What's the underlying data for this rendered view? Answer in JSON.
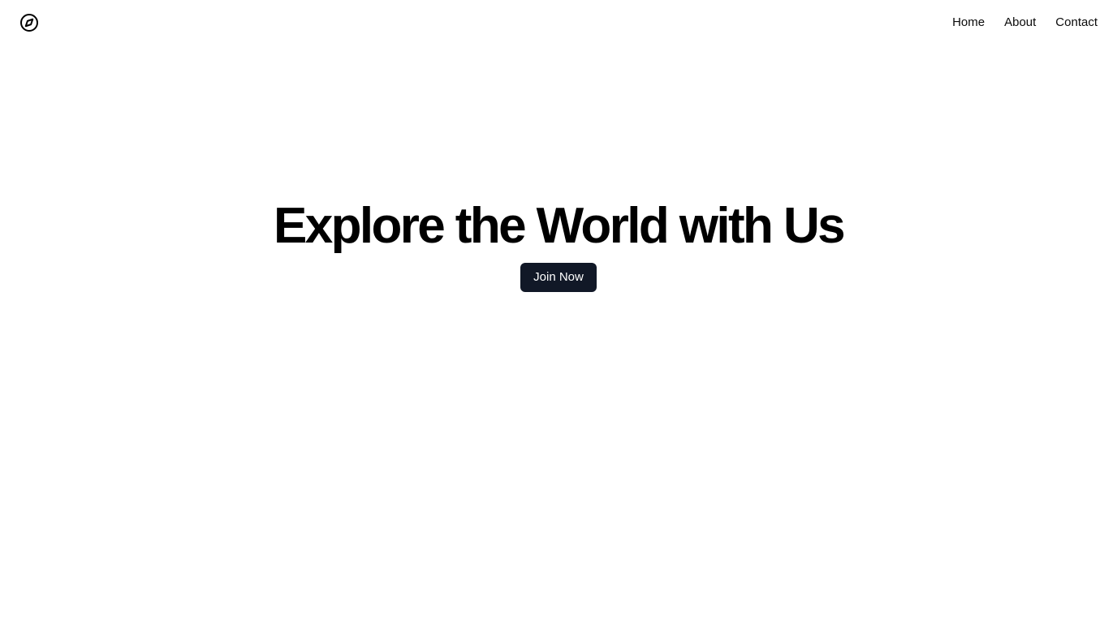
{
  "header": {
    "logo_icon": "compass-icon",
    "nav": [
      {
        "label": "Home"
      },
      {
        "label": "About"
      },
      {
        "label": "Contact"
      }
    ]
  },
  "hero": {
    "title": "Explore the World with Us",
    "cta_label": "Join Now"
  },
  "colors": {
    "background": "#ffffff",
    "text": "#000000",
    "button_bg": "#111827",
    "button_text": "#ffffff"
  }
}
